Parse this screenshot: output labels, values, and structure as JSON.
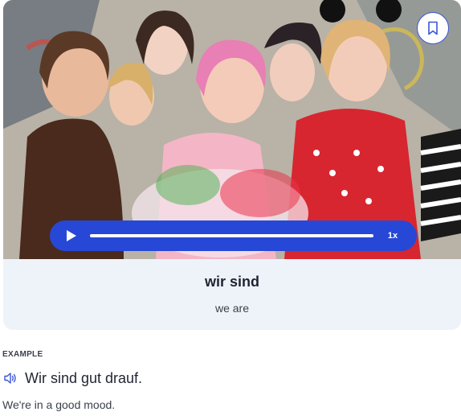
{
  "card": {
    "image_alt": "group-of-people-in-carnival-costumes",
    "bookmark_icon": "bookmark-icon",
    "player": {
      "play_icon": "play-icon",
      "progress": 0,
      "speed": "1x"
    },
    "word": "wir sind",
    "translation": "we are"
  },
  "example": {
    "label": "EXAMPLE",
    "speaker_icon": "speaker-icon",
    "sentence": "Wir sind gut drauf.",
    "translation": "We're in a good mood."
  },
  "colors": {
    "accent": "#2748d6",
    "card_bg": "#eef3fa",
    "text": "#1f2430"
  }
}
